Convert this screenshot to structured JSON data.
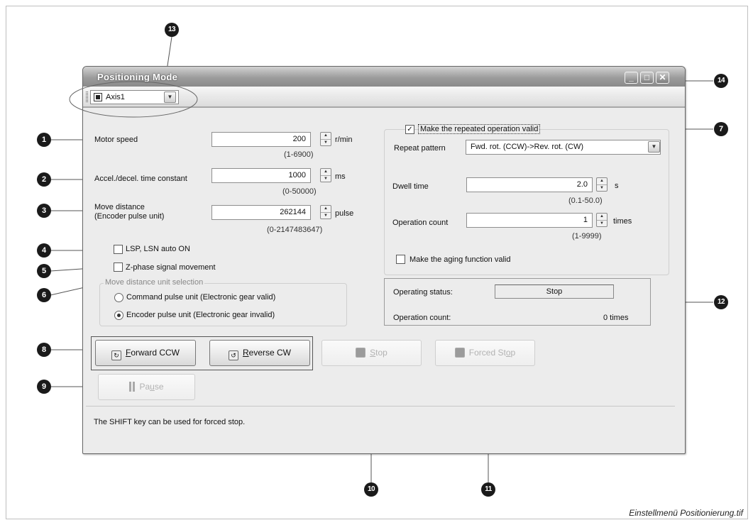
{
  "window": {
    "title": "Positioning Mode",
    "controls": [
      "_",
      "□",
      "✕"
    ]
  },
  "toolbar": {
    "axis_value": "Axis1",
    "dropdown_glyph": "▼"
  },
  "motor_speed": {
    "label": "Motor speed",
    "value": "200",
    "unit": "r/min",
    "range": "(1-6900)"
  },
  "accel": {
    "label": "Accel./decel. time constant",
    "value": "1000",
    "unit": "ms",
    "range": "(0-50000)"
  },
  "move_distance": {
    "label_line1": "Move distance",
    "label_line2": "(Encoder pulse unit)",
    "value": "262144",
    "unit": "pulse",
    "range": "(0-2147483647)"
  },
  "lsp_lsn": {
    "label": "LSP, LSN auto ON",
    "checked": false
  },
  "z_phase": {
    "label": "Z-phase signal movement",
    "checked": false
  },
  "unit_selection": {
    "title": "Move distance unit selection",
    "options": [
      {
        "label": "Command pulse unit (Electronic gear valid)",
        "selected": false
      },
      {
        "label": "Encoder pulse unit (Electronic gear invalid)",
        "selected": true
      }
    ]
  },
  "repeat": {
    "valid_label": "Make the repeated operation valid",
    "valid_checked": true,
    "pattern_label": "Repeat pattern",
    "pattern_value": "Fwd. rot. (CCW)->Rev. rot. (CW)",
    "dwell_label": "Dwell time",
    "dwell_value": "2.0",
    "dwell_unit": "s",
    "dwell_range": "(0.1-50.0)",
    "count_label": "Operation count",
    "count_value": "1",
    "count_unit": "times",
    "count_range": "(1-9999)",
    "aging_label": "Make the aging function valid",
    "aging_checked": false
  },
  "status": {
    "operating_label": "Operating status:",
    "operating_value": "Stop",
    "count_label": "Operation count:",
    "count_value": "0 times"
  },
  "buttons": {
    "forward_first": "F",
    "forward_rest": "orward CCW",
    "reverse_first": "R",
    "reverse_rest": "everse CW",
    "stop_first": "S",
    "stop_rest": "top",
    "forced_a": "Forced St",
    "forced_u": "o",
    "forced_b": "p",
    "pause_a": "Pa",
    "pause_u": "u",
    "pause_b": "se"
  },
  "footer_hint": "The SHIFT key can be used for forced stop.",
  "callouts": [
    "❶",
    "❷",
    "❸",
    "❹",
    "❺",
    "❻",
    "❼",
    "❽",
    "❾",
    "❿",
    "⓫",
    "⓬",
    "⓭",
    "⓮"
  ],
  "callout_labels": [
    "1",
    "2",
    "3",
    "4",
    "5",
    "6",
    "7",
    "8",
    "9",
    "10",
    "11",
    "12",
    "13",
    "14"
  ],
  "caption": "Einstellmenü Positionierung.tif"
}
